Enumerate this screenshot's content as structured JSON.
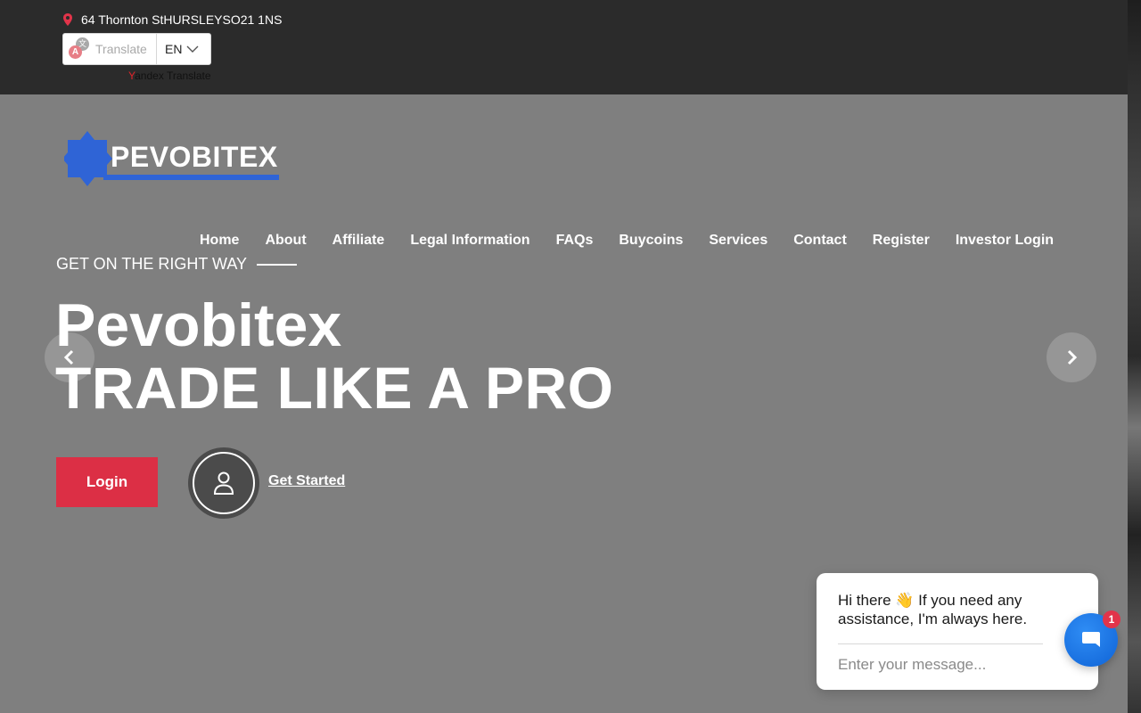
{
  "topbar": {
    "address": "64 Thornton StHURSLEYSO21 1NS",
    "translate": {
      "label": "Translate",
      "language": "EN"
    },
    "yandex": {
      "first_letter": "Y",
      "rest": "andex Translate"
    }
  },
  "brand": {
    "logo_text": "PEVOBITEX",
    "logo_color": "#2f64d6"
  },
  "nav": {
    "items": [
      {
        "label": "Home"
      },
      {
        "label": "About"
      },
      {
        "label": "Affiliate"
      },
      {
        "label": "Legal Information"
      },
      {
        "label": "FAQs"
      },
      {
        "label": "Buycoins"
      },
      {
        "label": "Services"
      },
      {
        "label": "Contact"
      },
      {
        "label": "Register"
      },
      {
        "label": "Investor Login"
      }
    ]
  },
  "hero": {
    "kicker": "GET ON THE RIGHT WAY",
    "title_line1": "Pevobitex",
    "title_line2": "TRADE LIKE A PRO",
    "login_label": "Login",
    "get_started_label": "Get Started"
  },
  "chat": {
    "message": "Hi there 👋 If you need any assistance, I'm always here.",
    "input_placeholder": "Enter your message...",
    "badge_count": "1",
    "accent": "#1a74e8"
  },
  "colors": {
    "topbar_bg": "#2b2b2b",
    "hero_overlay": "#7f7f7f",
    "login_button": "#dc2f45",
    "pin": "#e2344a"
  }
}
